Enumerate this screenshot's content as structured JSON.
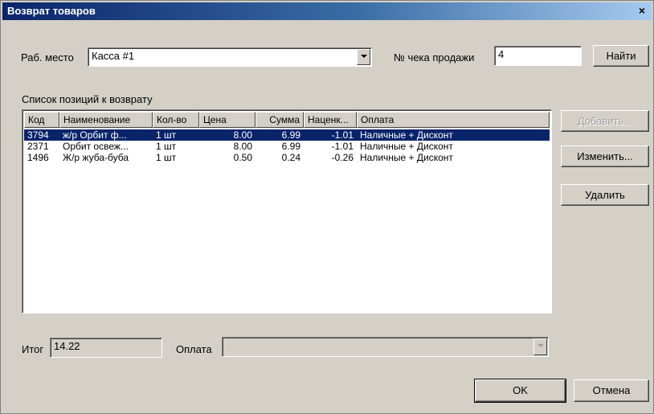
{
  "window": {
    "title": "Возврат товаров",
    "close_glyph": "×"
  },
  "workplace": {
    "label": "Раб. место",
    "value": "Касса #1"
  },
  "receipt": {
    "label": "№ чека продажи",
    "value": "4",
    "find_label": "Найти"
  },
  "list": {
    "label": "Список позиций к возврату",
    "columns": [
      "Код",
      "Наименование",
      "Кол-во",
      "Цена",
      "Сумма",
      "Наценк...",
      "Оплата"
    ],
    "rows": [
      [
        "3794",
        "ж/р Орбит ф...",
        "1 шт",
        "8.00",
        "6.99",
        "-1.01",
        "Наличные + Дисконт"
      ],
      [
        "2371",
        "Орбит освеж...",
        "1 шт",
        "8.00",
        "6.99",
        "-1.01",
        "Наличные + Дисконт"
      ],
      [
        "1496",
        "Ж/р жуба-буба",
        "1 шт",
        "0.50",
        "0.24",
        "-0.26",
        "Наличные + Дисконт"
      ]
    ],
    "selected_row": 0
  },
  "side_buttons": {
    "add": "Добавить...",
    "edit": "Изменить...",
    "delete": "Удалить"
  },
  "total": {
    "label": "Итог",
    "value": "14.22"
  },
  "payment": {
    "label": "Оплата",
    "value": ""
  },
  "footer": {
    "ok": "OK",
    "cancel": "Отмена"
  },
  "colors": {
    "title_start": "#0a246a",
    "title_end": "#a6caf0",
    "selection": "#0a246a",
    "face": "#d4d0c8"
  }
}
